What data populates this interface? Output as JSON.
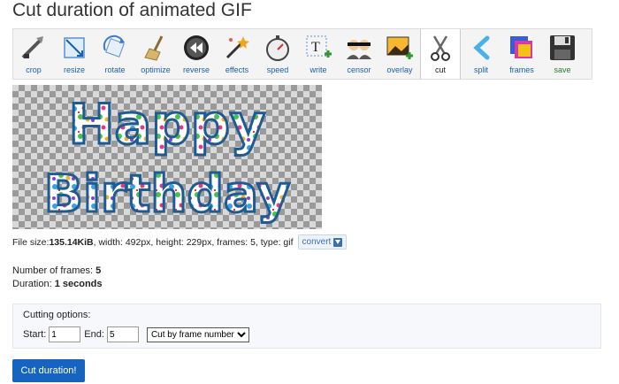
{
  "page": {
    "title": "Cut duration of animated GIF"
  },
  "toolbar": {
    "tools": [
      {
        "label": "crop",
        "icon": "crop-icon"
      },
      {
        "label": "resize",
        "icon": "resize-icon"
      },
      {
        "label": "rotate",
        "icon": "rotate-icon"
      },
      {
        "label": "optimize",
        "icon": "broom-icon"
      },
      {
        "label": "reverse",
        "icon": "reverse-icon"
      },
      {
        "label": "effects",
        "icon": "magic-wand-icon"
      },
      {
        "label": "speed",
        "icon": "stopwatch-icon"
      },
      {
        "label": "write",
        "icon": "text-tool-icon"
      },
      {
        "label": "censor",
        "icon": "censor-icon"
      },
      {
        "label": "overlay",
        "icon": "overlay-image-icon"
      },
      {
        "label": "cut",
        "icon": "scissors-icon"
      },
      {
        "label": "split",
        "icon": "split-icon"
      },
      {
        "label": "frames",
        "icon": "frames-icon"
      },
      {
        "label": "save",
        "icon": "floppy-disk-icon"
      }
    ],
    "active": "cut"
  },
  "preview": {
    "line1": "Happy",
    "line2": "Birthday"
  },
  "file_info": {
    "size_label": "File size: ",
    "size_value": "135.14KiB",
    "rest": ", width: 492px, height: 229px, frames: 5, type: gif",
    "convert_label": "convert"
  },
  "stats": {
    "frames_label": "Number of frames: ",
    "frames_value": "5",
    "duration_label": "Duration: ",
    "duration_value": "1 seconds"
  },
  "cutting": {
    "title": "Cutting options:",
    "start_label": "Start:",
    "start_value": "1",
    "end_label": "End:",
    "end_value": "5",
    "mode_selected": "Cut by frame number"
  },
  "submit_label": "Cut duration!",
  "colors": {
    "accent": "#1565c0",
    "link": "#1a5fb4"
  }
}
